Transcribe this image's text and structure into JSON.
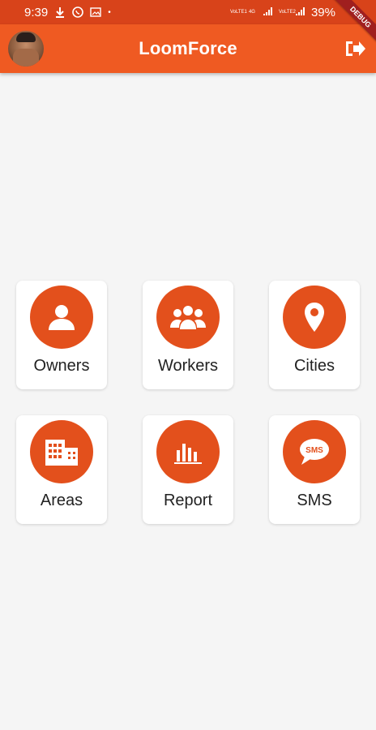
{
  "status_bar": {
    "time": "9:39",
    "net_left": "VoLTE1",
    "net_mid": "4G",
    "net_right": "VoLTE2",
    "battery": "39%"
  },
  "app_bar": {
    "title": "LoomForce"
  },
  "debug_banner": "DEBUG",
  "tiles": [
    {
      "label": "Owners",
      "icon": "person-icon"
    },
    {
      "label": "Workers",
      "icon": "group-icon"
    },
    {
      "label": "Cities",
      "icon": "location-pin-icon"
    },
    {
      "label": "Areas",
      "icon": "buildings-icon"
    },
    {
      "label": "Report",
      "icon": "bar-chart-icon"
    },
    {
      "label": "SMS",
      "icon": "sms-icon"
    }
  ],
  "colors": {
    "status_bar": "#d8431a",
    "app_bar": "#ef5a22",
    "tile_circle": "#e3501c",
    "background": "#f5f5f5"
  }
}
